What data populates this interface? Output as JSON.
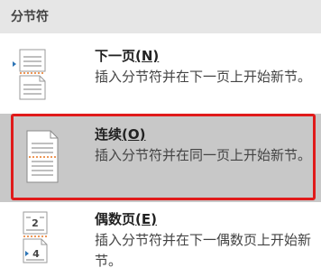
{
  "panel": {
    "header": "分节符"
  },
  "items": [
    {
      "title": "下一页",
      "key_label": "(N)",
      "description": "插入分节符并在下一页上开始新节。",
      "icon": "next-page-section-break-icon"
    },
    {
      "title": "连续",
      "key_label": "(O)",
      "description": "插入分节符并在同一页上开始新节。",
      "icon": "continuous-section-break-icon",
      "selected": true
    },
    {
      "title": "偶数页",
      "key_label": "(E)",
      "description": "插入分节符并在下一偶数页上开始新节。",
      "icon": "even-page-section-break-icon",
      "icon_numbers": [
        "2",
        "4"
      ]
    }
  ],
  "colors": {
    "highlight_border": "#e01b1b",
    "selected_background": "#c8c8c8",
    "icon_accent": "#e87722",
    "icon_blue": "#2e75b6"
  }
}
